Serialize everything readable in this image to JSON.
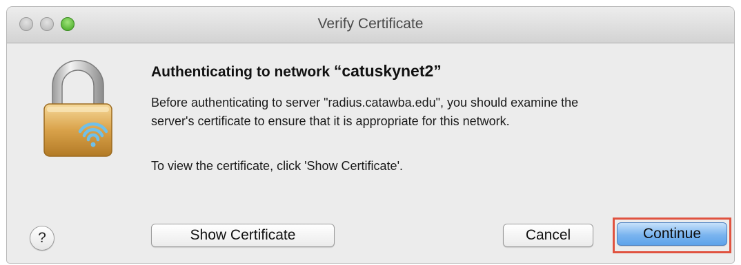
{
  "window": {
    "title": "Verify Certificate"
  },
  "dialog": {
    "heading_prefix": "Authenticating to network ",
    "network_name": "“catuskynet2”",
    "paragraph1_line1": "Before authenticating to server \"radius.catawba.edu\", you should examine the",
    "paragraph1_line2": "server's certificate to ensure that it is appropriate for this network.",
    "paragraph2": "To view the certificate, click 'Show Certificate'.",
    "icon": "wifi-padlock-icon"
  },
  "buttons": {
    "help_label": "?",
    "show_certificate_label": "Show Certificate",
    "cancel_label": "Cancel",
    "continue_label": "Continue"
  },
  "colors": {
    "highlight_border": "#e0523f",
    "default_button": "#5ea3ea",
    "zoom_button": "#3fa41e"
  }
}
